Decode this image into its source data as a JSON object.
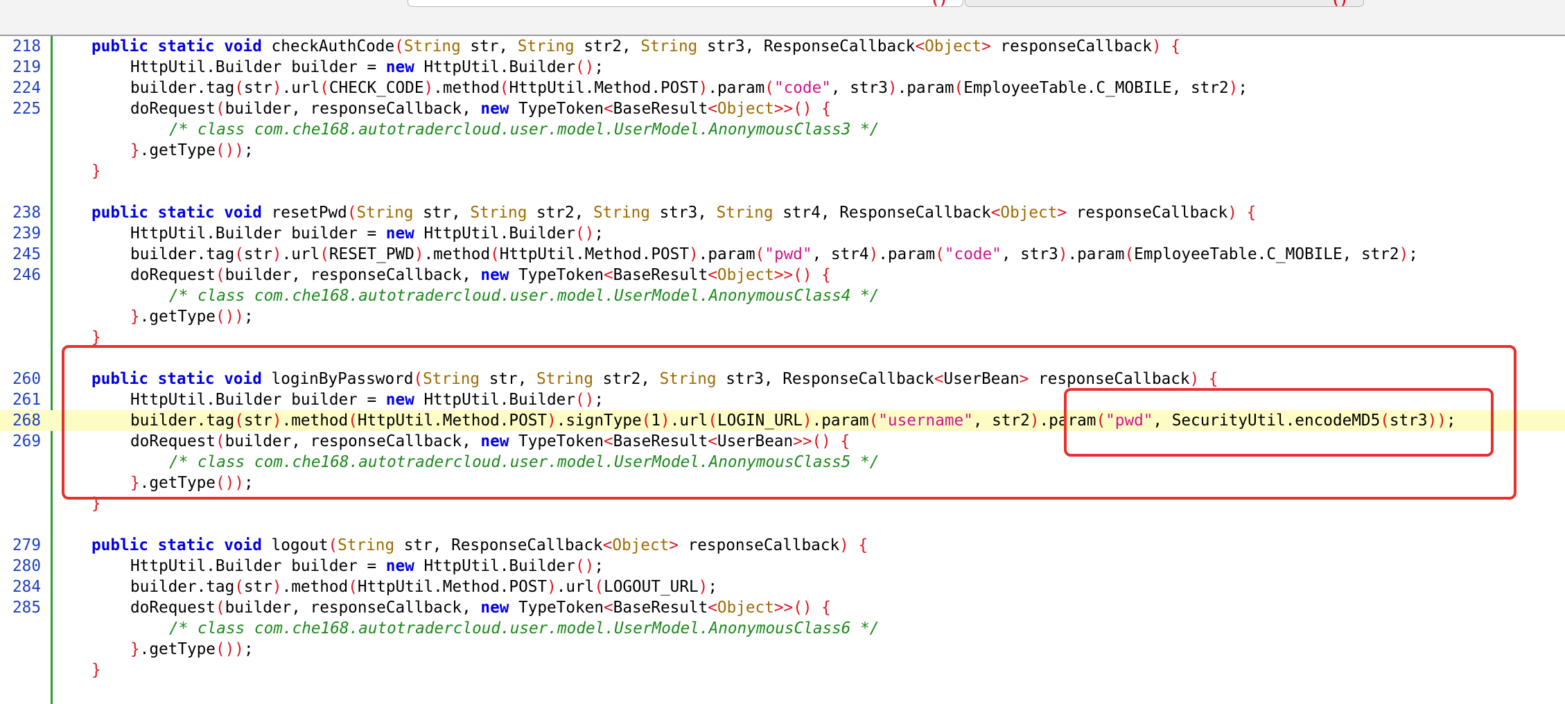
{
  "tabs": [
    {
      "label": "",
      "close": "()"
    },
    {
      "label": "",
      "close": "()"
    }
  ],
  "colors": {
    "gutter_line": "#2e9b35",
    "line_number": "#1f3fbf",
    "keyword": "#0000e6",
    "type": "#a06a00",
    "bracket": "#e0141e",
    "string": "#d4148a",
    "comment": "#1a8a1a",
    "highlight_row": "#fdfcc4",
    "annotation_box": "#e8302c"
  },
  "lines": [
    {
      "num": "218",
      "indent": 1,
      "tokens": [
        {
          "t": "kw",
          "v": "public static void"
        },
        {
          "t": "p",
          "v": " checkAuthCode"
        },
        {
          "t": "br",
          "v": "("
        },
        {
          "t": "ty",
          "v": "String"
        },
        {
          "t": "p",
          "v": " str, "
        },
        {
          "t": "ty",
          "v": "String"
        },
        {
          "t": "p",
          "v": " str2, "
        },
        {
          "t": "ty",
          "v": "String"
        },
        {
          "t": "p",
          "v": " str3, ResponseCallback"
        },
        {
          "t": "br",
          "v": "<"
        },
        {
          "t": "ty",
          "v": "Object"
        },
        {
          "t": "br",
          "v": ">"
        },
        {
          "t": "p",
          "v": " responseCallback"
        },
        {
          "t": "br",
          "v": ") {"
        }
      ]
    },
    {
      "num": "219",
      "indent": 2,
      "tokens": [
        {
          "t": "p",
          "v": "HttpUtil.Builder builder = "
        },
        {
          "t": "kw",
          "v": "new"
        },
        {
          "t": "p",
          "v": " HttpUtil.Builder"
        },
        {
          "t": "br",
          "v": "()"
        },
        {
          "t": "p",
          "v": ";"
        }
      ]
    },
    {
      "num": "224",
      "indent": 2,
      "tokens": [
        {
          "t": "p",
          "v": "builder.tag"
        },
        {
          "t": "br",
          "v": "("
        },
        {
          "t": "p",
          "v": "str"
        },
        {
          "t": "br",
          "v": ")"
        },
        {
          "t": "p",
          "v": ".url"
        },
        {
          "t": "br",
          "v": "("
        },
        {
          "t": "p",
          "v": "CHECK_CODE"
        },
        {
          "t": "br",
          "v": ")"
        },
        {
          "t": "p",
          "v": ".method"
        },
        {
          "t": "br",
          "v": "("
        },
        {
          "t": "p",
          "v": "HttpUtil.Method.POST"
        },
        {
          "t": "br",
          "v": ")"
        },
        {
          "t": "p",
          "v": ".param"
        },
        {
          "t": "br",
          "v": "("
        },
        {
          "t": "st",
          "v": "\"code\""
        },
        {
          "t": "p",
          "v": ", str3"
        },
        {
          "t": "br",
          "v": ")"
        },
        {
          "t": "p",
          "v": ".param"
        },
        {
          "t": "br",
          "v": "("
        },
        {
          "t": "p",
          "v": "EmployeeTable.C_MOBILE, str2"
        },
        {
          "t": "br",
          "v": ")"
        },
        {
          "t": "p",
          "v": ";"
        }
      ]
    },
    {
      "num": "225",
      "indent": 2,
      "tokens": [
        {
          "t": "p",
          "v": "doRequest"
        },
        {
          "t": "br",
          "v": "("
        },
        {
          "t": "p",
          "v": "builder, responseCallback, "
        },
        {
          "t": "kw",
          "v": "new"
        },
        {
          "t": "p",
          "v": " TypeToken"
        },
        {
          "t": "br",
          "v": "<"
        },
        {
          "t": "p",
          "v": "BaseResult"
        },
        {
          "t": "br",
          "v": "<"
        },
        {
          "t": "ty",
          "v": "Object"
        },
        {
          "t": "br",
          "v": ">>() {"
        }
      ]
    },
    {
      "num": "",
      "indent": 3,
      "tokens": [
        {
          "t": "cm",
          "v": "/* class com.che168.autotradercloud.user.model.UserModel.AnonymousClass3 */"
        }
      ]
    },
    {
      "num": "",
      "indent": 2,
      "tokens": [
        {
          "t": "br",
          "v": "}"
        },
        {
          "t": "p",
          "v": ".getType"
        },
        {
          "t": "br",
          "v": "())"
        },
        {
          "t": "p",
          "v": ";"
        }
      ]
    },
    {
      "num": "",
      "indent": 1,
      "tokens": [
        {
          "t": "br",
          "v": "}"
        }
      ]
    },
    {
      "num": "",
      "indent": 0,
      "tokens": []
    },
    {
      "num": "238",
      "indent": 1,
      "tokens": [
        {
          "t": "kw",
          "v": "public static void"
        },
        {
          "t": "p",
          "v": " resetPwd"
        },
        {
          "t": "br",
          "v": "("
        },
        {
          "t": "ty",
          "v": "String"
        },
        {
          "t": "p",
          "v": " str, "
        },
        {
          "t": "ty",
          "v": "String"
        },
        {
          "t": "p",
          "v": " str2, "
        },
        {
          "t": "ty",
          "v": "String"
        },
        {
          "t": "p",
          "v": " str3, "
        },
        {
          "t": "ty",
          "v": "String"
        },
        {
          "t": "p",
          "v": " str4, ResponseCallback"
        },
        {
          "t": "br",
          "v": "<"
        },
        {
          "t": "ty",
          "v": "Object"
        },
        {
          "t": "br",
          "v": ">"
        },
        {
          "t": "p",
          "v": " responseCallback"
        },
        {
          "t": "br",
          "v": ") {"
        }
      ]
    },
    {
      "num": "239",
      "indent": 2,
      "tokens": [
        {
          "t": "p",
          "v": "HttpUtil.Builder builder = "
        },
        {
          "t": "kw",
          "v": "new"
        },
        {
          "t": "p",
          "v": " HttpUtil.Builder"
        },
        {
          "t": "br",
          "v": "()"
        },
        {
          "t": "p",
          "v": ";"
        }
      ]
    },
    {
      "num": "245",
      "indent": 2,
      "tokens": [
        {
          "t": "p",
          "v": "builder.tag"
        },
        {
          "t": "br",
          "v": "("
        },
        {
          "t": "p",
          "v": "str"
        },
        {
          "t": "br",
          "v": ")"
        },
        {
          "t": "p",
          "v": ".url"
        },
        {
          "t": "br",
          "v": "("
        },
        {
          "t": "p",
          "v": "RESET_PWD"
        },
        {
          "t": "br",
          "v": ")"
        },
        {
          "t": "p",
          "v": ".method"
        },
        {
          "t": "br",
          "v": "("
        },
        {
          "t": "p",
          "v": "HttpUtil.Method.POST"
        },
        {
          "t": "br",
          "v": ")"
        },
        {
          "t": "p",
          "v": ".param"
        },
        {
          "t": "br",
          "v": "("
        },
        {
          "t": "st",
          "v": "\"pwd\""
        },
        {
          "t": "p",
          "v": ", str4"
        },
        {
          "t": "br",
          "v": ")"
        },
        {
          "t": "p",
          "v": ".param"
        },
        {
          "t": "br",
          "v": "("
        },
        {
          "t": "st",
          "v": "\"code\""
        },
        {
          "t": "p",
          "v": ", str3"
        },
        {
          "t": "br",
          "v": ")"
        },
        {
          "t": "p",
          "v": ".param"
        },
        {
          "t": "br",
          "v": "("
        },
        {
          "t": "p",
          "v": "EmployeeTable.C_MOBILE, str2"
        },
        {
          "t": "br",
          "v": ")"
        },
        {
          "t": "p",
          "v": ";"
        }
      ]
    },
    {
      "num": "246",
      "indent": 2,
      "tokens": [
        {
          "t": "p",
          "v": "doRequest"
        },
        {
          "t": "br",
          "v": "("
        },
        {
          "t": "p",
          "v": "builder, responseCallback, "
        },
        {
          "t": "kw",
          "v": "new"
        },
        {
          "t": "p",
          "v": " TypeToken"
        },
        {
          "t": "br",
          "v": "<"
        },
        {
          "t": "p",
          "v": "BaseResult"
        },
        {
          "t": "br",
          "v": "<"
        },
        {
          "t": "ty",
          "v": "Object"
        },
        {
          "t": "br",
          "v": ">>() {"
        }
      ]
    },
    {
      "num": "",
      "indent": 3,
      "tokens": [
        {
          "t": "cm",
          "v": "/* class com.che168.autotradercloud.user.model.UserModel.AnonymousClass4 */"
        }
      ]
    },
    {
      "num": "",
      "indent": 2,
      "tokens": [
        {
          "t": "br",
          "v": "}"
        },
        {
          "t": "p",
          "v": ".getType"
        },
        {
          "t": "br",
          "v": "())"
        },
        {
          "t": "p",
          "v": ";"
        }
      ]
    },
    {
      "num": "",
      "indent": 1,
      "tokens": [
        {
          "t": "br",
          "v": "}"
        }
      ]
    },
    {
      "num": "",
      "indent": 0,
      "tokens": []
    },
    {
      "num": "260",
      "indent": 1,
      "tokens": [
        {
          "t": "kw",
          "v": "public static void"
        },
        {
          "t": "p",
          "v": " loginByPassword"
        },
        {
          "t": "br",
          "v": "("
        },
        {
          "t": "ty",
          "v": "String"
        },
        {
          "t": "p",
          "v": " str, "
        },
        {
          "t": "ty",
          "v": "String"
        },
        {
          "t": "p",
          "v": " str2, "
        },
        {
          "t": "ty",
          "v": "String"
        },
        {
          "t": "p",
          "v": " str3, ResponseCallback"
        },
        {
          "t": "br",
          "v": "<"
        },
        {
          "t": "p",
          "v": "UserBean"
        },
        {
          "t": "br",
          "v": ">"
        },
        {
          "t": "p",
          "v": " responseCallback"
        },
        {
          "t": "br",
          "v": ") {"
        }
      ]
    },
    {
      "num": "261",
      "indent": 2,
      "tokens": [
        {
          "t": "p",
          "v": "HttpUtil.Builder builder = "
        },
        {
          "t": "kw",
          "v": "new"
        },
        {
          "t": "p",
          "v": " HttpUtil.Builder"
        },
        {
          "t": "br",
          "v": "()"
        },
        {
          "t": "p",
          "v": ";"
        }
      ]
    },
    {
      "num": "268",
      "indent": 2,
      "highlight": true,
      "tokens": [
        {
          "t": "p",
          "v": "builder.tag"
        },
        {
          "t": "br",
          "v": "("
        },
        {
          "t": "p",
          "v": "str"
        },
        {
          "t": "br",
          "v": ")"
        },
        {
          "t": "p",
          "v": ".method"
        },
        {
          "t": "br",
          "v": "("
        },
        {
          "t": "p",
          "v": "HttpUtil.Method.POST"
        },
        {
          "t": "br",
          "v": ")"
        },
        {
          "t": "p",
          "v": ".signType"
        },
        {
          "t": "br",
          "v": "("
        },
        {
          "t": "p",
          "v": "1"
        },
        {
          "t": "br",
          "v": ")"
        },
        {
          "t": "p",
          "v": ".url"
        },
        {
          "t": "br",
          "v": "("
        },
        {
          "t": "p",
          "v": "LOGIN_URL"
        },
        {
          "t": "br",
          "v": ")"
        },
        {
          "t": "p",
          "v": ".param"
        },
        {
          "t": "br",
          "v": "("
        },
        {
          "t": "st",
          "v": "\"username\""
        },
        {
          "t": "p",
          "v": ", str2"
        },
        {
          "t": "br",
          "v": ")"
        },
        {
          "t": "p",
          "v": ".param"
        },
        {
          "t": "br",
          "v": "("
        },
        {
          "t": "st",
          "v": "\"pwd\""
        },
        {
          "t": "p",
          "v": ", SecurityUtil.encodeMD5"
        },
        {
          "t": "br",
          "v": "("
        },
        {
          "t": "p",
          "v": "str3"
        },
        {
          "t": "br",
          "v": "))"
        },
        {
          "t": "p",
          "v": ";"
        }
      ]
    },
    {
      "num": "269",
      "indent": 2,
      "tokens": [
        {
          "t": "p",
          "v": "doRequest"
        },
        {
          "t": "br",
          "v": "("
        },
        {
          "t": "p",
          "v": "builder, responseCallback, "
        },
        {
          "t": "kw",
          "v": "new"
        },
        {
          "t": "p",
          "v": " TypeToken"
        },
        {
          "t": "br",
          "v": "<"
        },
        {
          "t": "p",
          "v": "BaseResult"
        },
        {
          "t": "br",
          "v": "<"
        },
        {
          "t": "p",
          "v": "UserBean"
        },
        {
          "t": "br",
          "v": ">>() {"
        }
      ]
    },
    {
      "num": "",
      "indent": 3,
      "tokens": [
        {
          "t": "cm",
          "v": "/* class com.che168.autotradercloud.user.model.UserModel.AnonymousClass5 */"
        }
      ]
    },
    {
      "num": "",
      "indent": 2,
      "tokens": [
        {
          "t": "br",
          "v": "}"
        },
        {
          "t": "p",
          "v": ".getType"
        },
        {
          "t": "br",
          "v": "())"
        },
        {
          "t": "p",
          "v": ";"
        }
      ]
    },
    {
      "num": "",
      "indent": 1,
      "tokens": [
        {
          "t": "br",
          "v": "}"
        }
      ]
    },
    {
      "num": "",
      "indent": 0,
      "tokens": []
    },
    {
      "num": "279",
      "indent": 1,
      "tokens": [
        {
          "t": "kw",
          "v": "public static void"
        },
        {
          "t": "p",
          "v": " logout"
        },
        {
          "t": "br",
          "v": "("
        },
        {
          "t": "ty",
          "v": "String"
        },
        {
          "t": "p",
          "v": " str, ResponseCallback"
        },
        {
          "t": "br",
          "v": "<"
        },
        {
          "t": "ty",
          "v": "Object"
        },
        {
          "t": "br",
          "v": ">"
        },
        {
          "t": "p",
          "v": " responseCallback"
        },
        {
          "t": "br",
          "v": ") {"
        }
      ]
    },
    {
      "num": "280",
      "indent": 2,
      "tokens": [
        {
          "t": "p",
          "v": "HttpUtil.Builder builder = "
        },
        {
          "t": "kw",
          "v": "new"
        },
        {
          "t": "p",
          "v": " HttpUtil.Builder"
        },
        {
          "t": "br",
          "v": "()"
        },
        {
          "t": "p",
          "v": ";"
        }
      ]
    },
    {
      "num": "284",
      "indent": 2,
      "tokens": [
        {
          "t": "p",
          "v": "builder.tag"
        },
        {
          "t": "br",
          "v": "("
        },
        {
          "t": "p",
          "v": "str"
        },
        {
          "t": "br",
          "v": ")"
        },
        {
          "t": "p",
          "v": ".method"
        },
        {
          "t": "br",
          "v": "("
        },
        {
          "t": "p",
          "v": "HttpUtil.Method.POST"
        },
        {
          "t": "br",
          "v": ")"
        },
        {
          "t": "p",
          "v": ".url"
        },
        {
          "t": "br",
          "v": "("
        },
        {
          "t": "p",
          "v": "LOGOUT_URL"
        },
        {
          "t": "br",
          "v": ")"
        },
        {
          "t": "p",
          "v": ";"
        }
      ]
    },
    {
      "num": "285",
      "indent": 2,
      "tokens": [
        {
          "t": "p",
          "v": "doRequest"
        },
        {
          "t": "br",
          "v": "("
        },
        {
          "t": "p",
          "v": "builder, responseCallback, "
        },
        {
          "t": "kw",
          "v": "new"
        },
        {
          "t": "p",
          "v": " TypeToken"
        },
        {
          "t": "br",
          "v": "<"
        },
        {
          "t": "p",
          "v": "BaseResult"
        },
        {
          "t": "br",
          "v": "<"
        },
        {
          "t": "ty",
          "v": "Object"
        },
        {
          "t": "br",
          "v": ">>() {"
        }
      ]
    },
    {
      "num": "",
      "indent": 3,
      "tokens": [
        {
          "t": "cm",
          "v": "/* class com.che168.autotradercloud.user.model.UserModel.AnonymousClass6 */"
        }
      ]
    },
    {
      "num": "",
      "indent": 2,
      "tokens": [
        {
          "t": "br",
          "v": "}"
        },
        {
          "t": "p",
          "v": ".getType"
        },
        {
          "t": "br",
          "v": "())"
        },
        {
          "t": "p",
          "v": ";"
        }
      ]
    },
    {
      "num": "",
      "indent": 1,
      "tokens": [
        {
          "t": "br",
          "v": "}"
        }
      ]
    }
  ]
}
